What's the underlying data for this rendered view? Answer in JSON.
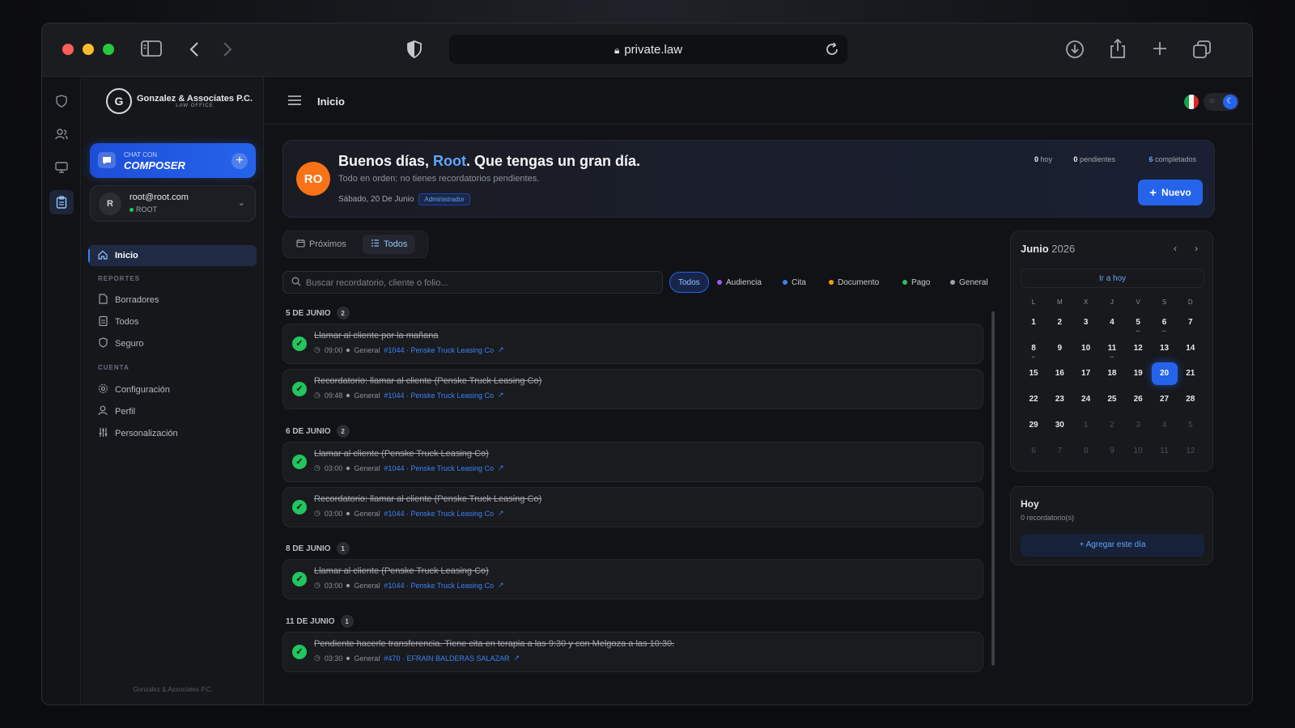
{
  "browser": {
    "url": "private.law",
    "colors": {
      "close": "#ff5f57",
      "minimize": "#febc2e",
      "maximize": "#28c840"
    }
  },
  "sidebar": {
    "logo_mark": "G",
    "logo_name": "Gonzalez & Associates P.C.",
    "logo_sub": "LAW OFFICE",
    "composer_line1": "CHAT CON",
    "composer_line2": "COMPOSER",
    "user_initial": "R",
    "user_email": "root@root.com",
    "user_role": "ROOT",
    "nav_home": "Inicio",
    "section_reports": "REPORTES",
    "reports": [
      "Borradores",
      "Todos",
      "Seguro"
    ],
    "section_account": "CUENTA",
    "account": [
      "Configuración",
      "Perfil",
      "Personalización"
    ],
    "footer": "Gonzalez & Associates P.C."
  },
  "topbar": {
    "breadcrumb": "Inicio"
  },
  "greeting": {
    "avatar": "RO",
    "prefix": "Buenos días, ",
    "name": "Root",
    "suffix": ". Que tengas un gran día.",
    "subtitle": "Todo en orden: no tienes recordatorios pendientes.",
    "date": "Sábado, 20 De Junio",
    "role_badge": "Administrador",
    "stats": [
      {
        "value": "0",
        "label": "hoy"
      },
      {
        "value": "0",
        "label": "pendientes"
      },
      {
        "value": "6",
        "label": "completados"
      }
    ],
    "new_button": "Nuevo"
  },
  "tabs": [
    "Próximos",
    "Todos"
  ],
  "search": {
    "placeholder": "Buscar recordatorio, cliente o folio..."
  },
  "filters": [
    {
      "label": "Todos",
      "color": ""
    },
    {
      "label": "Audiencia",
      "color": "#a855f7"
    },
    {
      "label": "Cita",
      "color": "#3b82f6"
    },
    {
      "label": "Documento",
      "color": "#f59e0b"
    },
    {
      "label": "Pago",
      "color": "#22c55e"
    },
    {
      "label": "General",
      "color": "#9ca3af"
    }
  ],
  "groups": [
    {
      "date": "5 DE JUNIO",
      "count": "2"
    },
    {
      "date": "6 DE JUNIO",
      "count": "2"
    },
    {
      "date": "8 DE JUNIO",
      "count": "1"
    },
    {
      "date": "11 DE JUNIO",
      "count": "1"
    }
  ],
  "reminders": [
    {
      "title": "Llamar al cliente por la mañana",
      "time": "09:00",
      "category": "General",
      "link": "#1044 · Penske Truck Leasing Co"
    },
    {
      "title": "Recordatorio: llamar al cliente (Penske Truck Leasing Co)",
      "time": "09:48",
      "category": "General",
      "link": "#1044 · Penske Truck Leasing Co"
    },
    {
      "title": "Llamar al cliente (Penske Truck Leasing Co)",
      "time": "03:00",
      "category": "General",
      "link": "#1044 · Penske Truck Leasing Co"
    },
    {
      "title": "Recordatorio: llamar al cliente (Penske Truck Leasing Co)",
      "time": "03:00",
      "category": "General",
      "link": "#1044 · Penske Truck Leasing Co"
    },
    {
      "title": "Llamar al cliente (Penske Truck Leasing Co)",
      "time": "03:00",
      "category": "General",
      "link": "#1044 · Penske Truck Leasing Co"
    },
    {
      "title": "Pendiente hacerle transferencia. Tiene cita en terapia a las 9:30 y con Melgoza a las 10:30.",
      "time": "03:30",
      "category": "General",
      "link": "#470 · EFRAIN BALDERAS SALAZAR"
    }
  ],
  "calendar": {
    "month": "Junio",
    "year": "2026",
    "today_button": "Ir a hoy",
    "weekdays": [
      "L",
      "M",
      "X",
      "J",
      "V",
      "S",
      "D"
    ],
    "days": [
      "1",
      "2",
      "3",
      "4",
      "5",
      "6",
      "7",
      "8",
      "9",
      "10",
      "11",
      "12",
      "13",
      "14",
      "15",
      "16",
      "17",
      "18",
      "19",
      "20",
      "21",
      "22",
      "23",
      "24",
      "25",
      "26",
      "27",
      "28",
      "29",
      "30"
    ],
    "next_days": [
      "1",
      "2",
      "3",
      "4",
      "5",
      "6",
      "7",
      "8",
      "9",
      "10",
      "11",
      "12"
    ],
    "selected": "20",
    "days_with_reminders": [
      "5",
      "6",
      "8",
      "11"
    ]
  },
  "today_panel": {
    "title": "Hoy",
    "count": "0 recordatorio(s)",
    "add_button": "Agregar este día"
  }
}
